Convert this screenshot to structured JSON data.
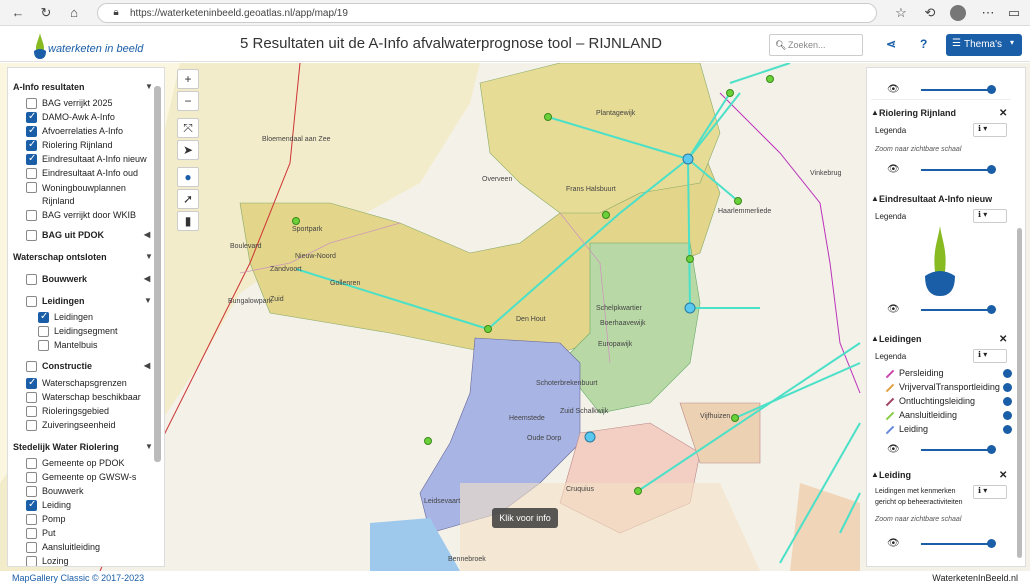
{
  "browser": {
    "url": "https://waterketeninbeeld.geoatlas.nl/app/map/19"
  },
  "header": {
    "logo_text": "waterketen in beeld",
    "title": "5 Resultaten uit de A-Info afvalwaterprognose tool – RIJNLAND",
    "search_placeholder": "Zoeken...",
    "themes_label": "Thema's"
  },
  "left_panel": {
    "groups": [
      {
        "label": "A-Info resultaten",
        "items": [
          {
            "label": "BAG verrijkt 2025",
            "checked": false
          },
          {
            "label": "DAMO-Awk A-Info",
            "checked": true
          },
          {
            "label": "Afvoerrelaties A-Info",
            "checked": true
          },
          {
            "label": "Riolering Rijnland",
            "checked": true
          },
          {
            "label": "Eindresultaat A-Info nieuw",
            "checked": true
          },
          {
            "label": "Eindresultaat A-Info oud",
            "checked": false
          },
          {
            "label": "Woningbouwplannen Rijnland",
            "checked": false
          },
          {
            "label": "BAG verrijkt door WKIB",
            "checked": false
          },
          {
            "label": "BAG uit PDOK",
            "checked": false
          }
        ]
      },
      {
        "label": "Waterschap ontsloten",
        "items": [
          {
            "label": "Bouwwerk",
            "checked": false
          },
          {
            "label": "Leidingen",
            "checked": false
          },
          {
            "label": "Leidingen",
            "checked": true
          },
          {
            "label": "Leidingsegment",
            "checked": false
          },
          {
            "label": "Mantelbuis",
            "checked": false
          },
          {
            "label": "Constructie",
            "checked": false
          },
          {
            "label": "Waterschapsgrenzen",
            "checked": true
          },
          {
            "label": "Waterschap beschikbaar",
            "checked": false
          },
          {
            "label": "Rioleringsgebied",
            "checked": false
          },
          {
            "label": "Zuiveringseenheid",
            "checked": false
          }
        ]
      },
      {
        "label": "Stedelijk Water Riolering",
        "items": [
          {
            "label": "Gemeente op PDOK",
            "checked": false
          },
          {
            "label": "Gemeente op GWSW-s",
            "checked": false
          },
          {
            "label": "Bouwwerk",
            "checked": false
          },
          {
            "label": "Leiding",
            "checked": true
          },
          {
            "label": "Pomp",
            "checked": false
          },
          {
            "label": "Put",
            "checked": false
          },
          {
            "label": "Aansluitleiding",
            "checked": false
          },
          {
            "label": "Lozing",
            "checked": false
          }
        ]
      }
    ]
  },
  "right_panel": {
    "legenda": "Legenda",
    "zoom_hint": "Zoom naar zichtbare schaal",
    "sections": [
      {
        "title": "Riolering Rijnland"
      },
      {
        "title": "Eindresultaat A-Info nieuw"
      },
      {
        "title": "Leidingen",
        "legend": [
          {
            "label": "Persleiding",
            "color": "#cc44aa"
          },
          {
            "label": "VrijvervalTransportleiding",
            "color": "#e0a040"
          },
          {
            "label": "Ontluchtingsleiding",
            "color": "#a04060"
          },
          {
            "label": "Aansluitleiding",
            "color": "#88cc44"
          },
          {
            "label": "Leiding",
            "color": "#6688dd"
          }
        ]
      },
      {
        "title": "Leiding",
        "desc": "Leidingen met kenmerken gericht op beheeractiviteiten"
      }
    ]
  },
  "map": {
    "klik_label": "Klik voor info",
    "place_labels": [
      "Zandvoort",
      "Bloemendaal aan Zee",
      "Overveen",
      "Haarlem",
      "Heemstede",
      "Schalkwijk",
      "Vijfhuizen",
      "Cruquius",
      "Bennebroek",
      "Oude Dorp",
      "Europawijk",
      "Boerhaavewijk",
      "Den Hout",
      "Zuid",
      "Noord",
      "Duinwijk",
      "Frans Halsbuurt",
      "Vinkebrug",
      "Haarlemmerliede",
      "Zuid Schalkwijk",
      "Schoterbrekenbuurt",
      "Leidsevaart",
      "Beeld",
      "Gollenren",
      "Bungalowpark",
      "Boulevard",
      "Nieuw-Noord",
      "Plantagewijk",
      "Sportpark"
    ]
  },
  "footer": {
    "left": "MapGallery Classic © 2017-2023",
    "right": "WaterketenInBeeld.nl"
  }
}
